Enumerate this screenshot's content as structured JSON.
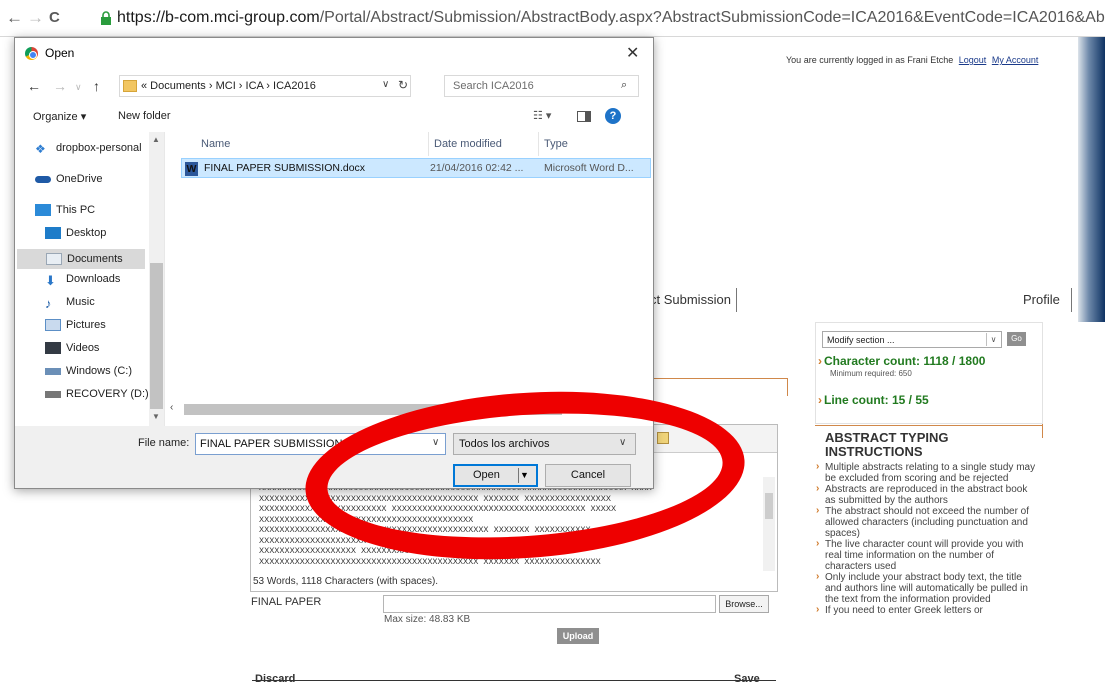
{
  "browser": {
    "back": "←",
    "forward": "→",
    "reload": "C",
    "url_host": "https://b-com.mci-group.com",
    "url_rest": "/Portal/Abstract/Submission/AbstractBody.aspx?AbstractSubmissionCode=ICA2016&EventCode=ICA2016&AbstractID"
  },
  "page": {
    "login_text": "You are currently logged in as Frani Etche",
    "logout_label": "Logout",
    "account_label": "My Account",
    "tab_submission": "ct Submission",
    "tab_profile": "Profile",
    "modify_select": "Modify section ...",
    "go_label": "Go",
    "char_count": "Character count: 1118 / 1800",
    "min_required": "Minimum required: 650",
    "line_count": "Line count: 15 / 55",
    "instructions_title": "ABSTRACT TYPING INSTRUCTIONS",
    "instructions": [
      "Multiple abstracts relating to a single study may be excluded from scoring and be rejected",
      "Abstracts are reproduced in the abstract book as submitted by the authors",
      "The abstract should not exceed the number of allowed characters (including punctuation and spaces)",
      "The live character count will provide you with real time information on the number of characters used",
      "Only include your abstract body text, the title and authors line will automatically be pulled in the text from the information provided",
      "If you need to enter Greek letters or"
    ],
    "editor_lines": [
      "XXXXXXXXXXXXXXXXXXXXXXXXXXXXXXXXXXXXXXXXXXXXXXXXXXXXXXXXXXXXXXXXXXXXXXXX XXXX",
      "XXXXXXXXXXXXXXXXXXXXXXXXXXXXXXXXXXXXXXXXXXX XXXXXXX XXXXXXXXXXXXXXXXX",
      "XXXXXXXXXXXXXXXXXXXXXXXXX XXXXXXXXXXXXXXXXXXXXXXXXXXXXXXXXXXXXXX XXXXX",
      "XXXXXXXXXXXXXXXXXXXXXXXXXXXXXXXXXXXXXXXXXX",
      "XXXXXXXXXXXXXXXXXXXXXXXXXXXXXXXXXXXXXXXXXXXXX XXXXXXX XXXXXXXXXXX",
      "XXXXXXXXXXXXXXXXXXXXX XXXXXXXXXXXXXXXXXXXXXXXXXXXXXXXXXXXXXX XXXXXXX",
      "XXXXXXXXXXXXXXXXXXX XXXXXXXXXXXXXXXXXXXXXX",
      "XXXXXXXXXXXXXXXXXXXXXXXXXXXXXXXXXXXXXXXXXXX XXXXXXX XXXXXXXXXXXXXXX"
    ],
    "word_count": "53 Words, 1118 Characters (with spaces).",
    "final_paper_label": "FINAL PAPER",
    "browse_label": "Browse...",
    "max_size": "Max size: 48.83 KB",
    "upload_label": "Upload",
    "discard_label": "Discard",
    "save_label": "Save"
  },
  "dialog": {
    "title": "Open",
    "close": "✕",
    "path": "« Documents › MCI › ICA › ICA2016",
    "search_placeholder": "Search ICA2016",
    "organize": "Organize ▾",
    "new_folder": "New folder",
    "nav_items": [
      {
        "label": "dropbox-personal",
        "icon": "dropbox-icon",
        "color": "#2e7dd1"
      },
      {
        "label": "OneDrive",
        "icon": "onedrive-icon",
        "color": "#1f5aa6"
      },
      {
        "label": "This PC",
        "icon": "computer-icon",
        "color": "#2b8ad8"
      },
      {
        "label": "Desktop",
        "icon": "desktop-icon",
        "color": "#1e7cc9"
      },
      {
        "label": "Documents",
        "icon": "documents-icon",
        "color": "#9aa7b5"
      },
      {
        "label": "Downloads",
        "icon": "downloads-icon",
        "color": "#2a77c8"
      },
      {
        "label": "Music",
        "icon": "music-icon",
        "color": "#1e5ea8"
      },
      {
        "label": "Pictures",
        "icon": "pictures-icon",
        "color": "#5c8fc6"
      },
      {
        "label": "Videos",
        "icon": "videos-icon",
        "color": "#333a44"
      },
      {
        "label": "Windows (C:)",
        "icon": "drive-icon",
        "color": "#6b8fb7"
      },
      {
        "label": "RECOVERY (D:)",
        "icon": "drive-icon",
        "color": "#777777"
      }
    ],
    "columns": [
      "Name",
      "Date modified",
      "Type"
    ],
    "file": {
      "name": "FINAL PAPER SUBMISSION.docx",
      "date": "21/04/2016 02:42 ...",
      "type": "Microsoft Word D..."
    },
    "file_name_label": "File name:",
    "file_name_value": "FINAL PAPER SUBMISSION.docx",
    "file_type": "Todos los archivos",
    "open_label": "Open",
    "cancel_label": "Cancel"
  },
  "colors": {
    "selection": "#cce8ff",
    "annotation": "#ee0000",
    "count_green": "#217a1f"
  }
}
